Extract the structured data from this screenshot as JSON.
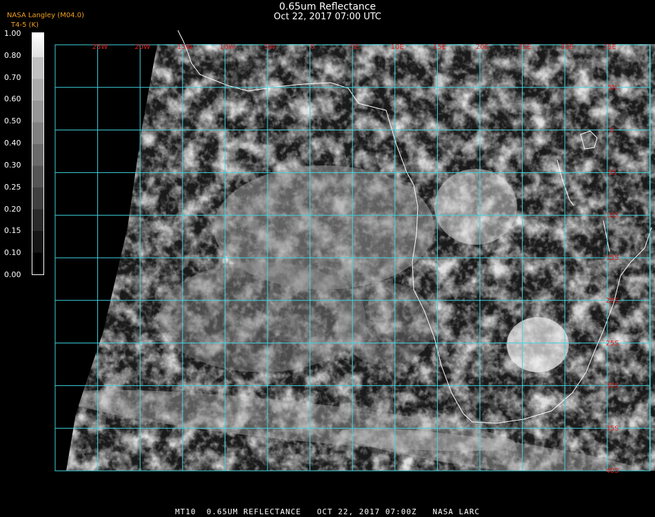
{
  "header": {
    "title": "0.65um Reflectance",
    "subtitle": "Oct 22, 2017 07:00 UTC"
  },
  "legend": {
    "source": "NASA Langley (M04.0)",
    "product": "T4-5 (K)",
    "ticks": [
      "1.00",
      "0.80",
      "0.70",
      "0.60",
      "0.50",
      "0.40",
      "0.30",
      "0.25",
      "0.20",
      "0.15",
      "0.10",
      "0.00"
    ]
  },
  "map": {
    "lon_labels": [
      "25W",
      "20W",
      "15W",
      "10W",
      "5W",
      "0",
      "5E",
      "10E",
      "15E",
      "20E",
      "25E",
      "30E",
      "35E"
    ],
    "lat_labels": [
      "5N",
      "0",
      "5S",
      "10S",
      "15S",
      "20S",
      "25S",
      "30S",
      "35S",
      "40S"
    ],
    "colors": {
      "grid": "#3fd4e0",
      "coast": "#ffffff",
      "labels": "#e02020"
    }
  },
  "footer": {
    "text": "MT10  0.65UM REFLECTANCE   OCT 22, 2017 07:00Z   NASA LARC"
  }
}
